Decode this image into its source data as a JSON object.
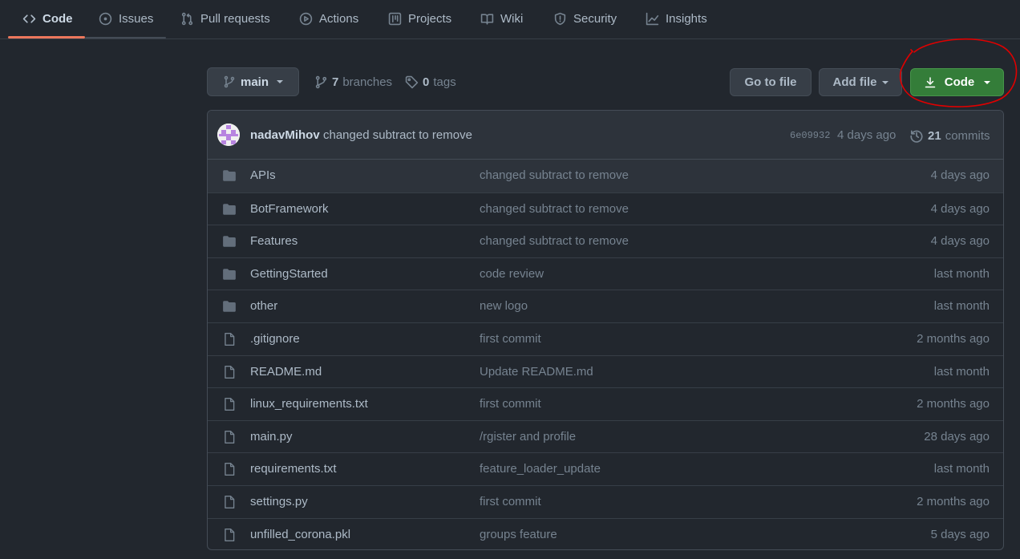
{
  "nav": {
    "tabs": [
      {
        "label": "Code",
        "icon": "code-icon",
        "selected": true
      },
      {
        "label": "Issues",
        "icon": "issue-opened-icon"
      },
      {
        "label": "Pull requests",
        "icon": "git-pull-request-icon"
      },
      {
        "label": "Actions",
        "icon": "play-icon"
      },
      {
        "label": "Projects",
        "icon": "table-icon"
      },
      {
        "label": "Wiki",
        "icon": "book-icon"
      },
      {
        "label": "Security",
        "icon": "shield-icon"
      },
      {
        "label": "Insights",
        "icon": "graph-icon"
      }
    ]
  },
  "filebar": {
    "branch": "main",
    "branches_count": "7",
    "branches_label": "branches",
    "tags_count": "0",
    "tags_label": "tags",
    "goto_file": "Go to file",
    "add_file": "Add file",
    "code": "Code"
  },
  "commit": {
    "author": "nadavMihov",
    "message": "changed subtract to remove",
    "sha": "6e09932",
    "age": "4 days ago",
    "count": "21",
    "count_label": "commits"
  },
  "files": [
    {
      "type": "dir",
      "name": "APIs",
      "message": "changed subtract to remove",
      "age": "4 days ago"
    },
    {
      "type": "dir",
      "name": "BotFramework",
      "message": "changed subtract to remove",
      "age": "4 days ago"
    },
    {
      "type": "dir",
      "name": "Features",
      "message": "changed subtract to remove",
      "age": "4 days ago"
    },
    {
      "type": "dir",
      "name": "GettingStarted",
      "message": "code review",
      "age": "last month"
    },
    {
      "type": "dir",
      "name": "other",
      "message": "new logo",
      "age": "last month"
    },
    {
      "type": "file",
      "name": ".gitignore",
      "message": "first commit",
      "age": "2 months ago"
    },
    {
      "type": "file",
      "name": "README.md",
      "message": "Update README.md",
      "age": "last month"
    },
    {
      "type": "file",
      "name": "linux_requirements.txt",
      "message": "first commit",
      "age": "2 months ago"
    },
    {
      "type": "file",
      "name": "main.py",
      "message": "/rgister and profile",
      "age": "28 days ago"
    },
    {
      "type": "file",
      "name": "requirements.txt",
      "message": "feature_loader_update",
      "age": "last month"
    },
    {
      "type": "file",
      "name": "settings.py",
      "message": "first commit",
      "age": "2 months ago"
    },
    {
      "type": "file",
      "name": "unfilled_corona.pkl",
      "message": "groups feature",
      "age": "5 days ago"
    }
  ],
  "colors": {
    "background": "#22272e",
    "accent_underline": "#ec775c",
    "primary_button": "#347d39",
    "annotation": "#e00000"
  }
}
